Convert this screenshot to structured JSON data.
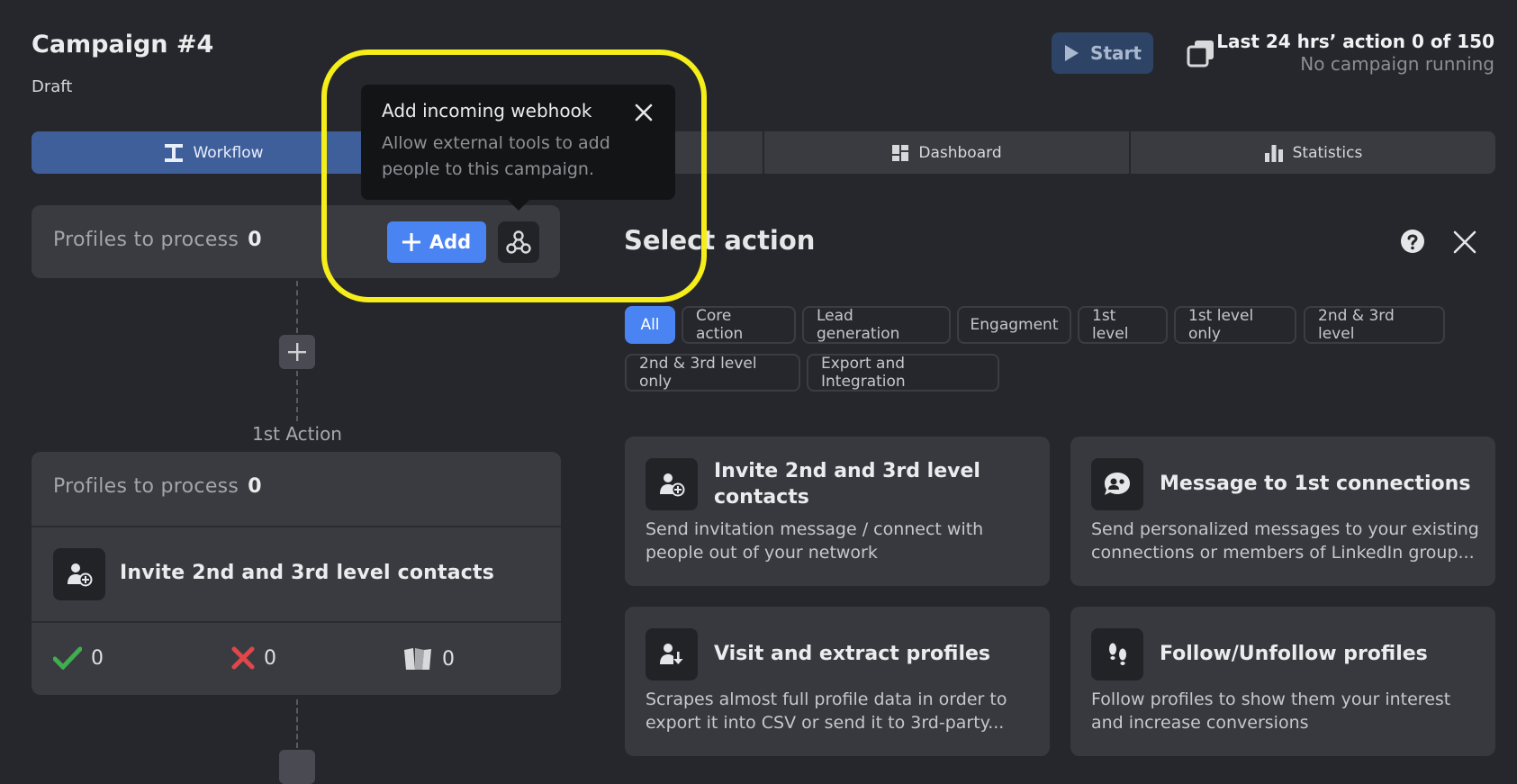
{
  "header": {
    "title": "Campaign #4",
    "status": "Draft",
    "start_label": "Start",
    "quota_line": "Last 24 hrs’ action 0 of 150",
    "running_line": "No campaign running"
  },
  "tabs": [
    {
      "label": "Workflow",
      "active": true
    },
    {
      "label": "",
      "active": false
    },
    {
      "label": "Dashboard",
      "active": false
    },
    {
      "label": "Statistics",
      "active": false
    }
  ],
  "workflow": {
    "top": {
      "label": "Profiles to process",
      "count": "0",
      "add_label": "Add"
    },
    "first_action_label": "1st Action",
    "action": {
      "label": "Profiles to process",
      "count": "0",
      "name": "Invite 2nd and 3rd level contacts",
      "success": "0",
      "failed": "0",
      "skipped": "0"
    }
  },
  "tooltip": {
    "title": "Add incoming webhook",
    "description": "Allow external tools to add people to this campaign."
  },
  "panel": {
    "title": "Select action",
    "filters": [
      "All",
      "Core action",
      "Lead generation",
      "Engagment",
      "1st level",
      "1st level only",
      "2nd & 3rd level",
      "2nd & 3rd level only",
      "Export and Integration"
    ],
    "actions": [
      {
        "name": "Invite 2nd and 3rd level contacts",
        "desc": "Send invitation message / connect with people out of your network",
        "icon": "user-plus-icon"
      },
      {
        "name": "Message to 1st connections",
        "desc": "Send personalized messages to your existing connections or members of LinkedIn group...",
        "icon": "message-user-icon"
      },
      {
        "name": "Visit and extract profiles",
        "desc": "Scrapes almost full profile data in order to export it into CSV or send it to 3rd-party...",
        "icon": "user-download-icon"
      },
      {
        "name": "Follow/Unfollow profiles",
        "desc": "Follow profiles to show them your interest and increase conversions",
        "icon": "footprints-icon"
      }
    ]
  },
  "colors": {
    "accent": "#4a83f2",
    "highlight": "#f5ee1a",
    "success": "#3fae4f",
    "error": "#e0474a"
  }
}
